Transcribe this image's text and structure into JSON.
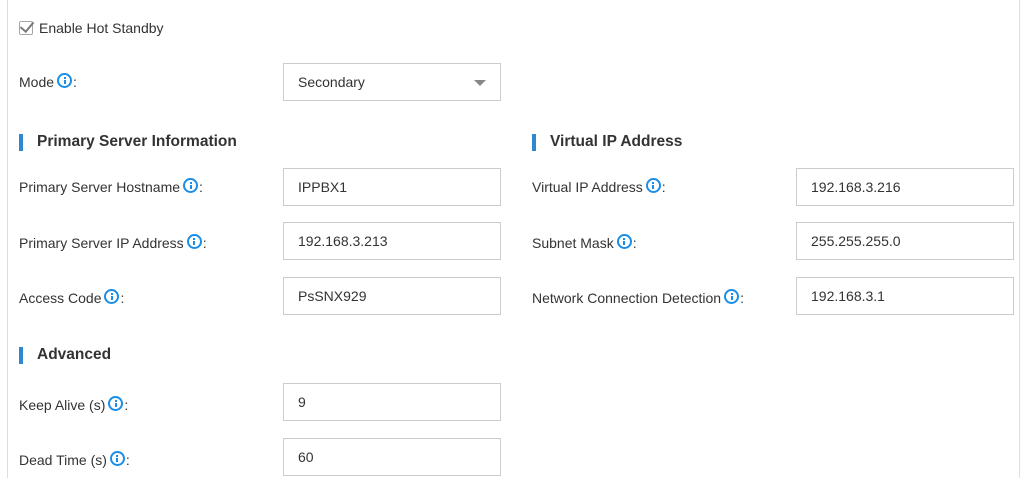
{
  "hot_standby": {
    "enable_label": "Enable Hot Standby",
    "checked": true
  },
  "mode": {
    "label": "Mode",
    "suffix": ":",
    "value": "Secondary"
  },
  "primary_section": {
    "title": "Primary Server Information",
    "hostname": {
      "label": "Primary Server Hostname",
      "suffix": ":",
      "value": "IPPBX1"
    },
    "ip_address": {
      "label": "Primary Server IP Address",
      "suffix": ":",
      "value": "192.168.3.213"
    },
    "access_code": {
      "label": "Access Code",
      "suffix": ":",
      "value": "PsSNX929"
    }
  },
  "virtual_section": {
    "title": "Virtual IP Address",
    "virtual_ip": {
      "label": "Virtual IP Address",
      "suffix": ":",
      "value": "192.168.3.216"
    },
    "subnet_mask": {
      "label": "Subnet Mask",
      "suffix": ":",
      "value": "255.255.255.0"
    },
    "detection": {
      "label": "Network Connection Detection",
      "suffix": ":",
      "value": "192.168.3.1"
    }
  },
  "advanced_section": {
    "title": "Advanced",
    "keep_alive": {
      "label": "Keep Alive (s)",
      "suffix": ":",
      "value": "9"
    },
    "dead_time": {
      "label": "Dead Time (s)",
      "suffix": ":",
      "value": "60"
    }
  },
  "colors": {
    "accent": "#2f88cf",
    "info_icon": "#1a8ee6",
    "border": "#cccccc"
  },
  "icons": {
    "info": "info-circle-icon",
    "checkbox_tick": "check-icon",
    "dropdown": "chevron-down-icon"
  }
}
